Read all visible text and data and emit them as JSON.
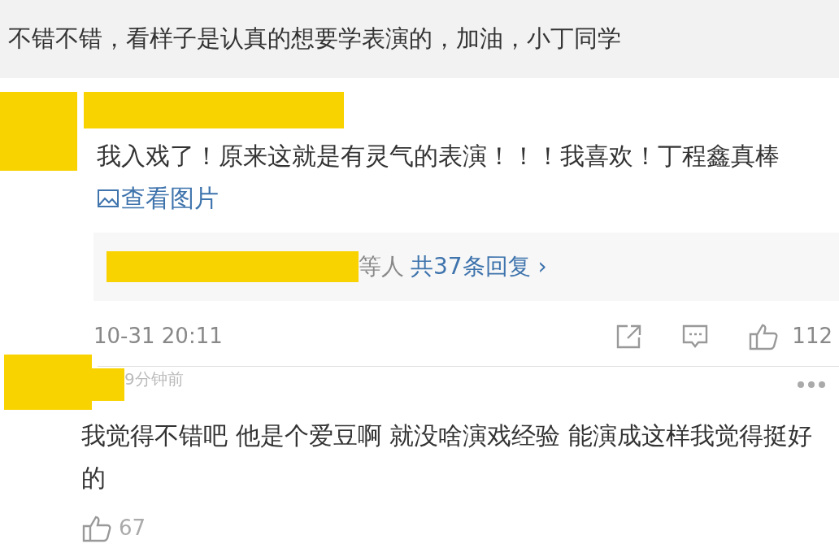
{
  "top_comment": {
    "text": "不错不错，看样子是认真的想要学表演的，加油，小丁同学"
  },
  "comments": [
    {
      "text": "我入戏了！原来这就是有灵气的表演！！！我喜欢！丁程鑫真棒",
      "link": "查看图片",
      "replies": {
        "suffix": "等人",
        "count": "共37条回复",
        "arrow": "›"
      },
      "time": "10-31 20:11",
      "likes": "112"
    },
    {
      "time": "9分钟前",
      "text": "我觉得不错吧 他是个爱豆啊 就没啥演戏经验 能演成这样我觉得挺好的",
      "likes": "67"
    }
  ]
}
